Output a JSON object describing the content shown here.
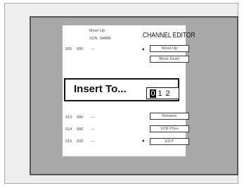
{
  "editor": {
    "title": "CHANNEL EDITOR",
    "header_top": "Move Up",
    "columns": [
      "SCN",
      "NAME"
    ],
    "rows": [
      {
        "num": "005",
        "scn": "000",
        "name": "---"
      },
      {
        "num": "",
        "scn": "",
        "name": ""
      },
      {
        "num": "",
        "scn": "",
        "name": ""
      },
      {
        "num": "",
        "scn": "",
        "name": ""
      },
      {
        "num": "",
        "scn": "",
        "name": ""
      },
      {
        "num": "013",
        "scn": "000",
        "name": "---"
      },
      {
        "num": "014",
        "scn": "000",
        "name": "---"
      },
      {
        "num": "015",
        "scn": "000",
        "name": "---"
      }
    ],
    "buttons": [
      {
        "label": "Move Up"
      },
      {
        "label": "Move Down"
      },
      {
        "label": "Rename"
      },
      {
        "label": "VCR Pos+"
      },
      {
        "label": "EXIT"
      }
    ],
    "arrow_symbol": "♦"
  },
  "dialog": {
    "title": "Insert To...",
    "digits": [
      "0",
      "1",
      "2"
    ],
    "selected_digit": 0
  }
}
